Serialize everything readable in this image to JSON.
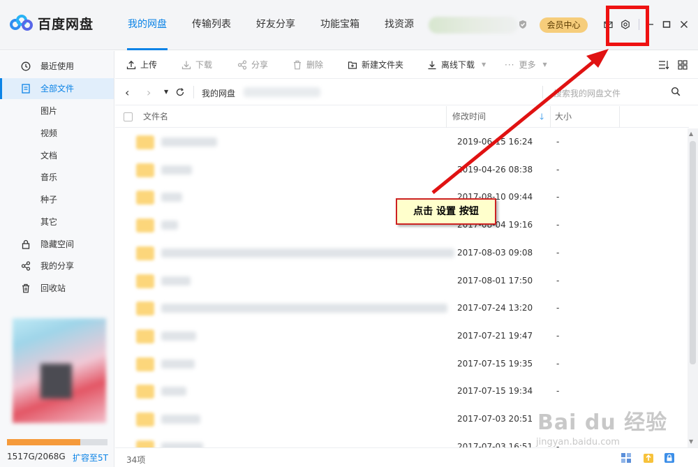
{
  "app": {
    "name": "百度网盘"
  },
  "nav": {
    "tabs": [
      {
        "label": "我的网盘",
        "active": true
      },
      {
        "label": "传输列表"
      },
      {
        "label": "好友分享"
      },
      {
        "label": "功能宝箱"
      },
      {
        "label": "找资源"
      }
    ]
  },
  "header": {
    "vip_label": "会员中心",
    "icons": [
      "mail-icon",
      "settings-icon",
      "minimize-icon",
      "maximize-icon",
      "close-icon"
    ]
  },
  "sidebar": {
    "items": [
      {
        "label": "最近使用",
        "icon": "clock-icon"
      },
      {
        "label": "全部文件",
        "icon": "file-icon",
        "active": true
      },
      {
        "label": "图片"
      },
      {
        "label": "视频"
      },
      {
        "label": "文档"
      },
      {
        "label": "音乐"
      },
      {
        "label": "种子"
      },
      {
        "label": "其它"
      },
      {
        "label": "隐藏空间",
        "icon": "lock-icon"
      },
      {
        "label": "我的分享",
        "icon": "share-icon"
      },
      {
        "label": "回收站",
        "icon": "trash-icon"
      }
    ],
    "quota_text": "1517G/2068G",
    "quota_fraction": 0.73,
    "expand_link": "扩容至5T"
  },
  "toolbar": {
    "upload": "上传",
    "download": "下载",
    "share": "分享",
    "delete": "删除",
    "new_folder": "新建文件夹",
    "offline_download": "离线下载",
    "more": "更多"
  },
  "address": {
    "crumb": "我的网盘",
    "search_placeholder": "搜索我的网盘文件"
  },
  "table": {
    "col_name": "文件名",
    "col_time": "修改时间",
    "col_size": "大小",
    "rows": [
      {
        "time": "2019-06-15 16:24",
        "size": "-"
      },
      {
        "time": "2019-04-26 08:38",
        "size": "-"
      },
      {
        "time": "2017-08-10 09:44",
        "size": "-"
      },
      {
        "time": "2017-08-04 19:16",
        "size": "-"
      },
      {
        "time": "2017-08-03 09:08",
        "size": "-"
      },
      {
        "time": "2017-08-01 17:50",
        "size": "-"
      },
      {
        "time": "2017-07-24 13:20",
        "size": "-"
      },
      {
        "time": "2017-07-21 19:47",
        "size": "-"
      },
      {
        "time": "2017-07-15 19:35",
        "size": "-"
      },
      {
        "time": "2017-07-15 19:34",
        "size": "-"
      },
      {
        "time": "2017-07-03 20:51",
        "size": "-"
      },
      {
        "time": "2017-07-03 16:51",
        "size": "-"
      }
    ]
  },
  "status": {
    "count": "34项"
  },
  "callout": {
    "text": "点击 设置 按钮"
  },
  "watermark": {
    "brand": "Bai du 经验",
    "url": "jingyan.baidu.com"
  },
  "colors": {
    "accent": "#0b83e6",
    "highlight": "#ee1111",
    "vip": "#f6cd7b",
    "quota": "#f59a3b"
  }
}
